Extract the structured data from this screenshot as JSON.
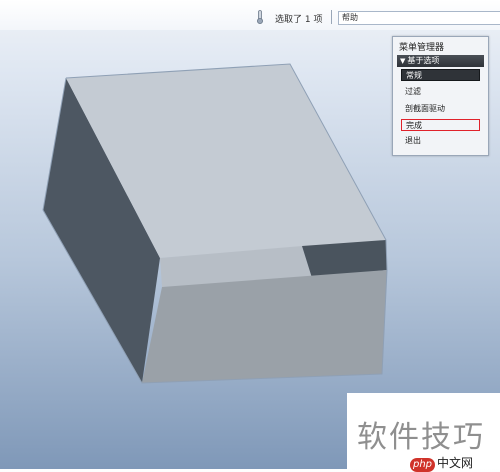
{
  "toolbar": {
    "selection_text": "选取了 1 项",
    "help_input_value": "帮助"
  },
  "menu_manager": {
    "title": "菜单管理器",
    "group_label": "基于选项",
    "items": [
      "常规",
      "过滤",
      "剖截面驱动",
      "完成",
      "退出"
    ]
  },
  "colors": {
    "selected_item": "#2f3338",
    "highlight_border": "#e0222b",
    "model_top": "#c3cad2",
    "model_left": "#4c5660",
    "model_front": "#9aa1a8"
  },
  "watermark": {
    "text": "软件技巧",
    "logo_php": "php",
    "logo_cn": "中文网"
  }
}
